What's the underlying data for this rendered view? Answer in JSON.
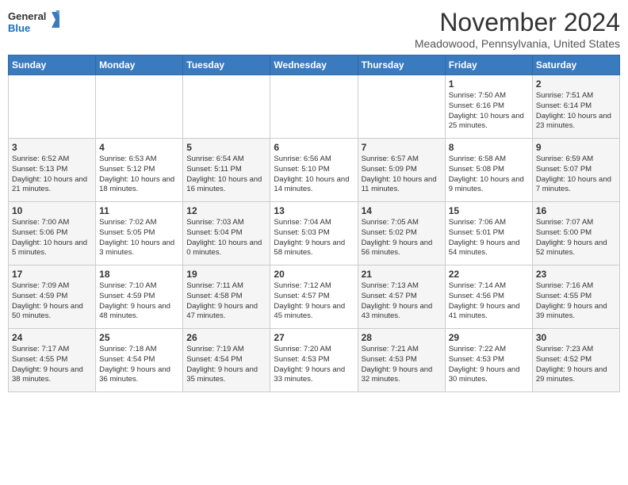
{
  "logo": {
    "line1": "General",
    "line2": "Blue"
  },
  "title": "November 2024",
  "location": "Meadowood, Pennsylvania, United States",
  "days_of_week": [
    "Sunday",
    "Monday",
    "Tuesday",
    "Wednesday",
    "Thursday",
    "Friday",
    "Saturday"
  ],
  "weeks": [
    [
      {
        "day": "",
        "info": ""
      },
      {
        "day": "",
        "info": ""
      },
      {
        "day": "",
        "info": ""
      },
      {
        "day": "",
        "info": ""
      },
      {
        "day": "",
        "info": ""
      },
      {
        "day": "1",
        "info": "Sunrise: 7:50 AM\nSunset: 6:16 PM\nDaylight: 10 hours and 25 minutes."
      },
      {
        "day": "2",
        "info": "Sunrise: 7:51 AM\nSunset: 6:14 PM\nDaylight: 10 hours and 23 minutes."
      }
    ],
    [
      {
        "day": "3",
        "info": "Sunrise: 6:52 AM\nSunset: 5:13 PM\nDaylight: 10 hours and 21 minutes."
      },
      {
        "day": "4",
        "info": "Sunrise: 6:53 AM\nSunset: 5:12 PM\nDaylight: 10 hours and 18 minutes."
      },
      {
        "day": "5",
        "info": "Sunrise: 6:54 AM\nSunset: 5:11 PM\nDaylight: 10 hours and 16 minutes."
      },
      {
        "day": "6",
        "info": "Sunrise: 6:56 AM\nSunset: 5:10 PM\nDaylight: 10 hours and 14 minutes."
      },
      {
        "day": "7",
        "info": "Sunrise: 6:57 AM\nSunset: 5:09 PM\nDaylight: 10 hours and 11 minutes."
      },
      {
        "day": "8",
        "info": "Sunrise: 6:58 AM\nSunset: 5:08 PM\nDaylight: 10 hours and 9 minutes."
      },
      {
        "day": "9",
        "info": "Sunrise: 6:59 AM\nSunset: 5:07 PM\nDaylight: 10 hours and 7 minutes."
      }
    ],
    [
      {
        "day": "10",
        "info": "Sunrise: 7:00 AM\nSunset: 5:06 PM\nDaylight: 10 hours and 5 minutes."
      },
      {
        "day": "11",
        "info": "Sunrise: 7:02 AM\nSunset: 5:05 PM\nDaylight: 10 hours and 3 minutes."
      },
      {
        "day": "12",
        "info": "Sunrise: 7:03 AM\nSunset: 5:04 PM\nDaylight: 10 hours and 0 minutes."
      },
      {
        "day": "13",
        "info": "Sunrise: 7:04 AM\nSunset: 5:03 PM\nDaylight: 9 hours and 58 minutes."
      },
      {
        "day": "14",
        "info": "Sunrise: 7:05 AM\nSunset: 5:02 PM\nDaylight: 9 hours and 56 minutes."
      },
      {
        "day": "15",
        "info": "Sunrise: 7:06 AM\nSunset: 5:01 PM\nDaylight: 9 hours and 54 minutes."
      },
      {
        "day": "16",
        "info": "Sunrise: 7:07 AM\nSunset: 5:00 PM\nDaylight: 9 hours and 52 minutes."
      }
    ],
    [
      {
        "day": "17",
        "info": "Sunrise: 7:09 AM\nSunset: 4:59 PM\nDaylight: 9 hours and 50 minutes."
      },
      {
        "day": "18",
        "info": "Sunrise: 7:10 AM\nSunset: 4:59 PM\nDaylight: 9 hours and 48 minutes."
      },
      {
        "day": "19",
        "info": "Sunrise: 7:11 AM\nSunset: 4:58 PM\nDaylight: 9 hours and 47 minutes."
      },
      {
        "day": "20",
        "info": "Sunrise: 7:12 AM\nSunset: 4:57 PM\nDaylight: 9 hours and 45 minutes."
      },
      {
        "day": "21",
        "info": "Sunrise: 7:13 AM\nSunset: 4:57 PM\nDaylight: 9 hours and 43 minutes."
      },
      {
        "day": "22",
        "info": "Sunrise: 7:14 AM\nSunset: 4:56 PM\nDaylight: 9 hours and 41 minutes."
      },
      {
        "day": "23",
        "info": "Sunrise: 7:16 AM\nSunset: 4:55 PM\nDaylight: 9 hours and 39 minutes."
      }
    ],
    [
      {
        "day": "24",
        "info": "Sunrise: 7:17 AM\nSunset: 4:55 PM\nDaylight: 9 hours and 38 minutes."
      },
      {
        "day": "25",
        "info": "Sunrise: 7:18 AM\nSunset: 4:54 PM\nDaylight: 9 hours and 36 minutes."
      },
      {
        "day": "26",
        "info": "Sunrise: 7:19 AM\nSunset: 4:54 PM\nDaylight: 9 hours and 35 minutes."
      },
      {
        "day": "27",
        "info": "Sunrise: 7:20 AM\nSunset: 4:53 PM\nDaylight: 9 hours and 33 minutes."
      },
      {
        "day": "28",
        "info": "Sunrise: 7:21 AM\nSunset: 4:53 PM\nDaylight: 9 hours and 32 minutes."
      },
      {
        "day": "29",
        "info": "Sunrise: 7:22 AM\nSunset: 4:53 PM\nDaylight: 9 hours and 30 minutes."
      },
      {
        "day": "30",
        "info": "Sunrise: 7:23 AM\nSunset: 4:52 PM\nDaylight: 9 hours and 29 minutes."
      }
    ]
  ]
}
